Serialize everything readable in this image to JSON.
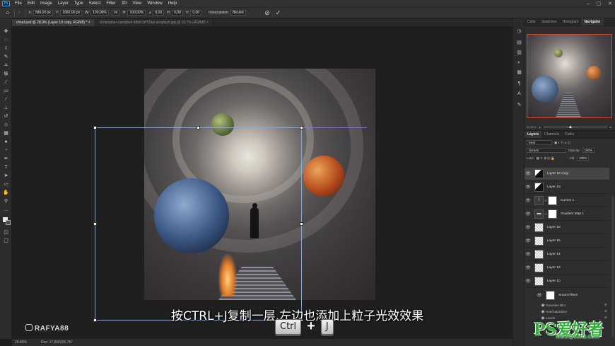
{
  "menu": [
    "File",
    "Edit",
    "Image",
    "Layer",
    "Type",
    "Select",
    "Filter",
    "3D",
    "View",
    "Window",
    "Help"
  ],
  "app_logo": "Ps",
  "window_controls": [
    "–",
    "▢",
    "✕"
  ],
  "options": {
    "x_label": "X:",
    "x_value": "586,00 px",
    "y_label": "Y:",
    "y_value": "1082,00 px",
    "w_label": "W:",
    "w_value": "100,00%",
    "link_label": "oo",
    "h_label": "H:",
    "h_value": "100,00%",
    "rotate_label": "⊿",
    "rotate_value": "0,00",
    "hskew_label": "H:",
    "hskew_value": "0,00",
    "vskew_label": "V:",
    "vskew_value": "0,00",
    "interpolation_label": "Interpolation:",
    "interpolation_value": "Bicubic"
  },
  "tabs": [
    {
      "label": "cloud.psd @ 28,9% (Layer 19 copy, RGB/8) * ×",
      "active": true
    },
    {
      "label": "christopher-campbell-h8tbClzf7Zws-unsplash.jpg @ 16,7% (RGB/8) ×",
      "active": false
    }
  ],
  "caption": "按CTRL+J复制一层,左边也添加上粒子光效效果",
  "keys": {
    "ctrl": "Ctrl",
    "plus": "+",
    "j": "J"
  },
  "watermark": "RAFYA88",
  "status": {
    "zoom": "28,89%",
    "doc": "Doc: 17,8M/295,7M"
  },
  "navigator": {
    "tabs": [
      "Color",
      "Swatches",
      "Histogram",
      "Navigator"
    ],
    "zoom": "28,89%"
  },
  "layers_panel": {
    "tabs": [
      "Layers",
      "Channels",
      "Paths"
    ],
    "kind": "Kind",
    "blend_mode": "Screen",
    "opacity_label": "Opacity:",
    "opacity_value": "100%",
    "lock_label": "Lock:",
    "fill_label": "Fill:",
    "fill_value": "100%",
    "layers": [
      {
        "name": "Layer 19 copy",
        "thumb": "dark",
        "selected": true
      },
      {
        "name": "Layer 19",
        "thumb": "dark",
        "selected": false
      },
      {
        "name": "Curves 1",
        "thumb": "adj",
        "selected": false
      },
      {
        "name": "Gradient Map 1",
        "thumb": "adj",
        "selected": false
      },
      {
        "name": "Layer 18",
        "thumb": "checker",
        "selected": false
      },
      {
        "name": "Layer 15",
        "thumb": "checker",
        "selected": false
      },
      {
        "name": "Layer 14",
        "thumb": "checker",
        "selected": false
      },
      {
        "name": "Layer 13",
        "thumb": "checker",
        "selected": false
      },
      {
        "name": "Layer 10",
        "thumb": "checker",
        "selected": false
      }
    ],
    "smart_filters": "Smart Filters",
    "filters": [
      "Gaussian Blur",
      "Hue/Saturation",
      "Levels"
    ]
  },
  "brand": {
    "name": "PS爱好者",
    "url": "www.psahz.com"
  },
  "colors": {
    "accent": "#31a8ff",
    "selection_box": "#8fa6c9",
    "guide": "#8a72c9",
    "brand_green": "#2fae3a",
    "nav_frame": "#d24b2a"
  }
}
